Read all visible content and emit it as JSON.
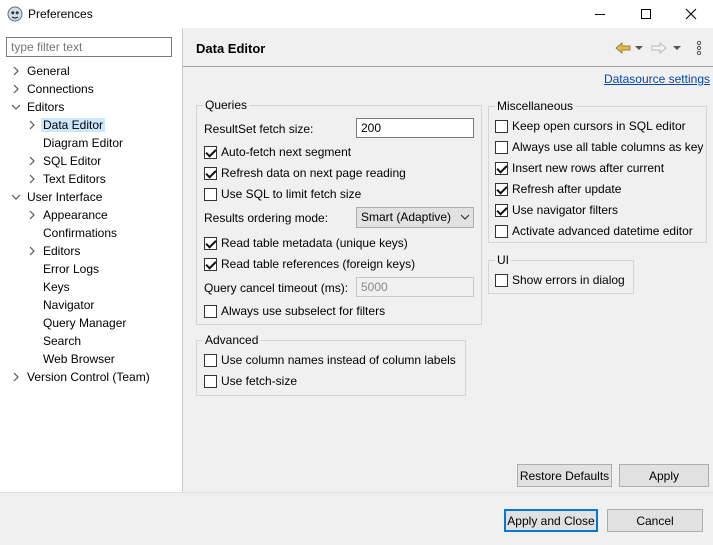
{
  "window": {
    "title": "Preferences"
  },
  "filter": {
    "placeholder": "type filter text"
  },
  "tree": [
    {
      "label": "General",
      "expander": "collapsed"
    },
    {
      "label": "Connections",
      "expander": "collapsed"
    },
    {
      "label": "Editors",
      "expander": "expanded"
    },
    {
      "label": "Data Editor",
      "expander": "collapsed",
      "selected": true
    },
    {
      "label": "Diagram Editor",
      "expander": "none"
    },
    {
      "label": "SQL Editor",
      "expander": "collapsed"
    },
    {
      "label": "Text Editors",
      "expander": "collapsed"
    },
    {
      "label": "User Interface",
      "expander": "expanded"
    },
    {
      "label": "Appearance",
      "expander": "collapsed"
    },
    {
      "label": "Confirmations",
      "expander": "none"
    },
    {
      "label": "Editors",
      "expander": "collapsed"
    },
    {
      "label": "Error Logs",
      "expander": "none"
    },
    {
      "label": "Keys",
      "expander": "none"
    },
    {
      "label": "Navigator",
      "expander": "none"
    },
    {
      "label": "Query Manager",
      "expander": "none"
    },
    {
      "label": "Search",
      "expander": "none"
    },
    {
      "label": "Web Browser",
      "expander": "none"
    },
    {
      "label": "Version Control (Team)",
      "expander": "collapsed"
    }
  ],
  "page": {
    "title": "Data Editor",
    "link": "Datasource settings",
    "queries": {
      "title": "Queries",
      "fetch_size_label": "ResultSet fetch size:",
      "fetch_size_value": "200",
      "auto_fetch": {
        "label": "Auto-fetch next segment",
        "checked": true
      },
      "refresh_data": {
        "label": "Refresh data on next page reading",
        "checked": true
      },
      "use_sql_limit": {
        "label": "Use SQL to limit fetch size",
        "checked": false
      },
      "ordering_label": "Results ordering mode:",
      "ordering_value": "Smart (Adaptive)",
      "read_metadata": {
        "label": "Read table metadata (unique keys)",
        "checked": true
      },
      "read_references": {
        "label": "Read table references (foreign keys)",
        "checked": true
      },
      "cancel_timeout_label": "Query cancel timeout (ms):",
      "cancel_timeout_value": "5000",
      "always_subselect": {
        "label": "Always use subselect for filters",
        "checked": false
      }
    },
    "advanced": {
      "title": "Advanced",
      "column_names": {
        "label": "Use column names instead of column labels",
        "checked": false
      },
      "use_fetch_size": {
        "label": "Use fetch-size",
        "checked": false
      }
    },
    "misc": {
      "title": "Miscellaneous",
      "keep_cursors": {
        "label": "Keep open cursors in SQL editor",
        "checked": false
      },
      "all_columns_key": {
        "label": "Always use all table columns as key",
        "checked": false
      },
      "insert_after_current": {
        "label": "Insert new rows after current",
        "checked": true
      },
      "refresh_after_update": {
        "label": "Refresh after update",
        "checked": true
      },
      "navigator_filters": {
        "label": "Use navigator filters",
        "checked": true
      },
      "datetime_editor": {
        "label": "Activate advanced datetime editor",
        "checked": false
      }
    },
    "ui": {
      "title": "UI",
      "show_errors": {
        "label": "Show errors in dialog",
        "checked": false
      }
    },
    "buttons": {
      "restore_defaults": "Restore Defaults",
      "apply": "Apply"
    }
  },
  "footer": {
    "apply_close": "Apply and Close",
    "cancel": "Cancel"
  },
  "colors": {
    "selection": "#cce8ff",
    "link": "#0645ad",
    "nav_back": "#e8b84a",
    "default_button_border": "#0078d7"
  }
}
